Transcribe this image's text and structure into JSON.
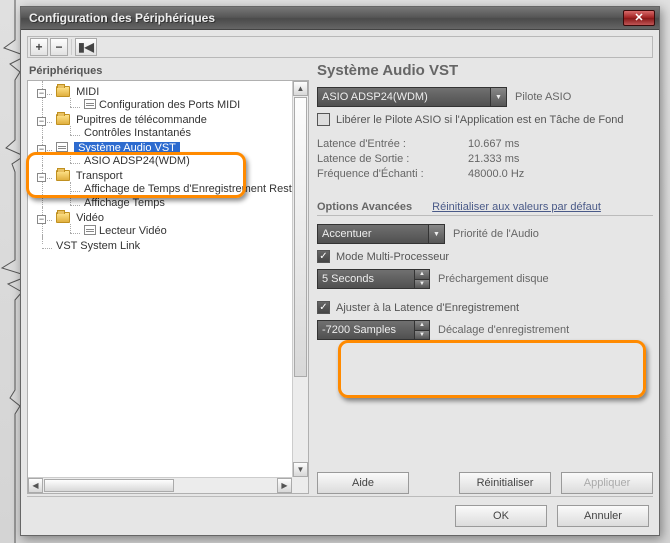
{
  "window": {
    "title": "Configuration des Périphériques"
  },
  "toolbar": {
    "add": "+",
    "remove": "−",
    "rewind": "▮◀"
  },
  "left": {
    "header": "Périphériques",
    "tree": {
      "midi": "MIDI",
      "midi_ports": "Configuration des Ports MIDI",
      "remote": "Pupitres de télécommande",
      "instant_controls": "Contrôles Instantanés",
      "vst_audio": "Système Audio VST",
      "asio_device": "ASIO ADSP24(WDM)",
      "transport": "Transport",
      "record_time_display": "Affichage de Temps d'Enregistrement Restant",
      "time_display": "Affichage Temps",
      "video": "Vidéo",
      "video_player": "Lecteur Vidéo",
      "vst_system_link": "VST System Link"
    }
  },
  "right": {
    "title": "Système Audio VST",
    "driver_select": "ASIO ADSP24(WDM)",
    "driver_label": "Pilote ASIO",
    "release_bg": "Libérer le Pilote ASIO si l'Application est en Tâche de Fond",
    "input_latency_k": "Latence d'Entrée :",
    "input_latency_v": "10.667 ms",
    "output_latency_k": "Latence de Sortie :",
    "output_latency_v": "21.333 ms",
    "sample_rate_k": "Fréquence d'Échanti :",
    "sample_rate_v": "48000.0 Hz",
    "adv_title": "Options Avancées",
    "adv_reset": "Réinitialiser aux valeurs par défaut",
    "priority_select": "Accentuer",
    "priority_label": "Priorité de l'Audio",
    "multiproc": "Mode Multi-Processeur",
    "preload_value": "5 Seconds",
    "preload_label": "Préchargement disque",
    "adjust_latency": "Ajuster à la Latence d'Enregistrement",
    "offset_value": "-7200 Samples",
    "offset_label": "Décalage d'enregistrement",
    "help_btn": "Aide",
    "reset_btn": "Réinitialiser",
    "apply_btn": "Appliquer"
  },
  "footer": {
    "ok": "OK",
    "cancel": "Annuler"
  }
}
